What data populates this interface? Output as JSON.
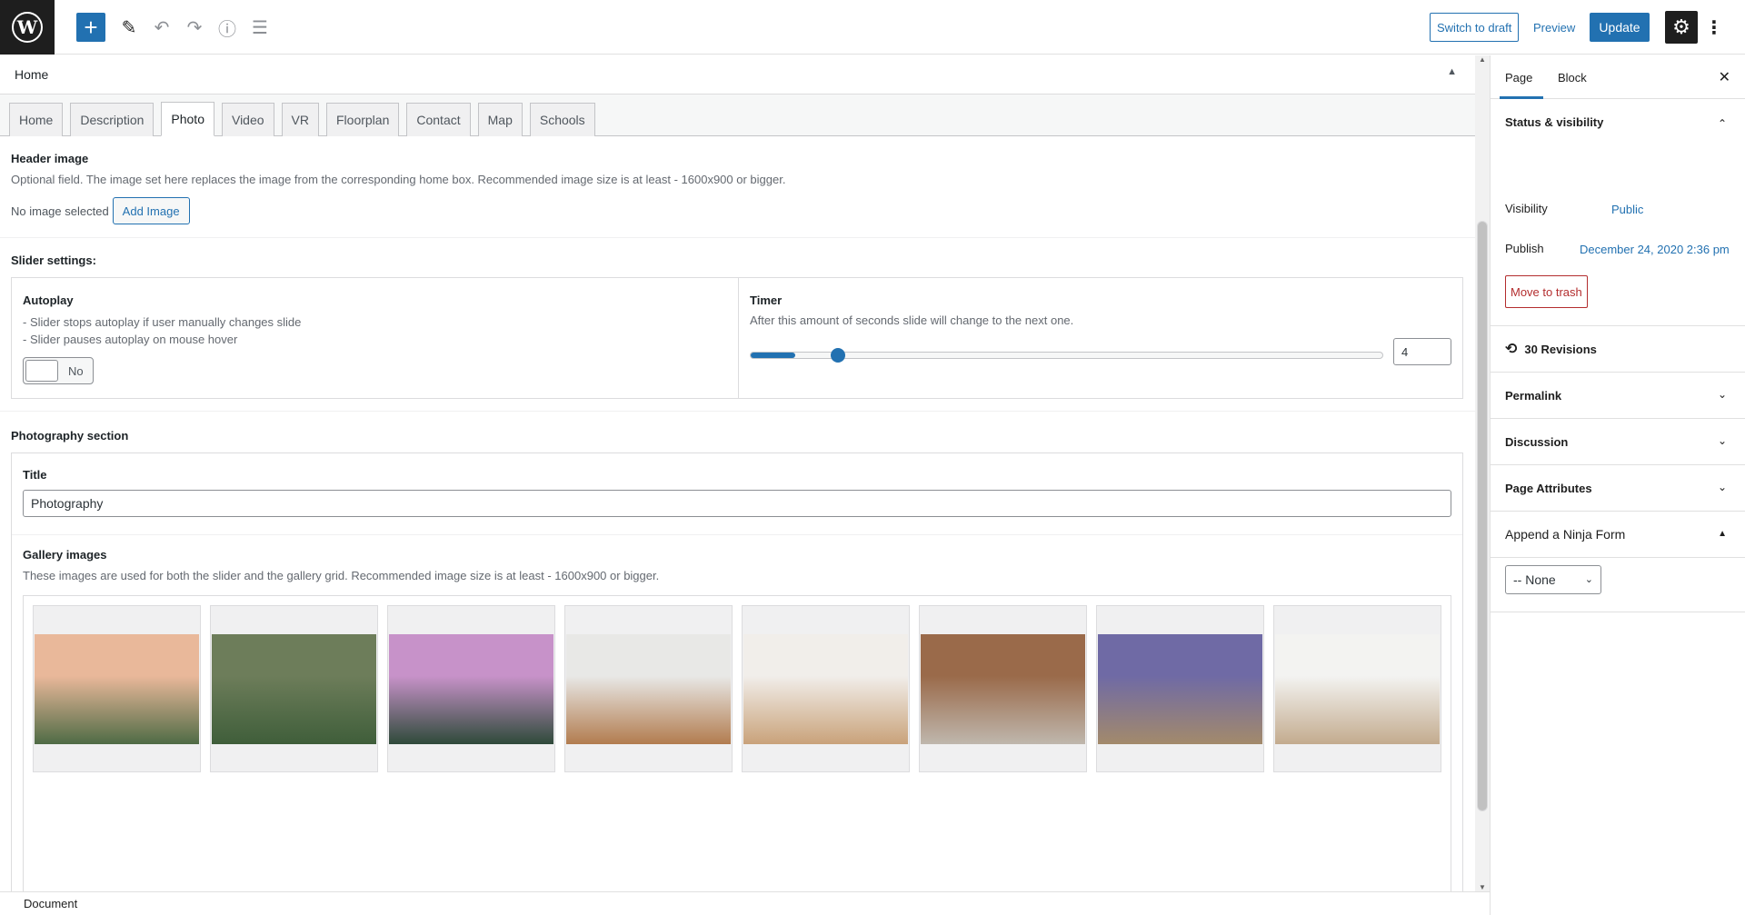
{
  "toolbar": {
    "logo_letter": "W",
    "add_icon": "+",
    "pencil_icon": "✎",
    "undo_icon": "↶",
    "redo_icon": "↷",
    "info_icon": "ⓘ",
    "outline_icon": "☰",
    "switch_to_draft": "Switch to draft",
    "preview": "Preview",
    "update": "Update",
    "settings_icon": "⚙",
    "more_icon": "⋮"
  },
  "metabox": {
    "title": "Home",
    "toggle_icon": "▲",
    "tabs": [
      "Home",
      "Description",
      "Photo",
      "Video",
      "VR",
      "Floorplan",
      "Contact",
      "Map",
      "Schools"
    ],
    "active_tab": "Photo"
  },
  "header_image": {
    "label": "Header image",
    "description": "Optional field. The image set here replaces the image from the corresponding home box. Recommended image size is at least - 1600x900 or bigger.",
    "no_image": "No image selected",
    "add_image": "Add Image"
  },
  "slider": {
    "section_label": "Slider settings:",
    "autoplay_label": "Autoplay",
    "autoplay_desc_1": "- Slider stops autoplay if user manually changes slide",
    "autoplay_desc_2": "- Slider pauses autoplay on mouse hover",
    "autoplay_value": "No",
    "timer_label": "Timer",
    "timer_desc": "After this amount of seconds slide will change to the next one.",
    "timer_value": "4",
    "timer_fraction": 0.07
  },
  "photography": {
    "section_label": "Photography section",
    "title_label": "Title",
    "title_value": "Photography",
    "gallery_label": "Gallery images",
    "gallery_desc": "These images are used for both the slider and the gallery grid. Recommended image size is at least - 1600x900 or bigger.",
    "images": [
      {
        "kind": "aerial-neighborhood",
        "sky": "#e9b89a",
        "ground": "#4f6b45"
      },
      {
        "kind": "aerial-house-tennis",
        "sky": "#6d7d5a",
        "ground": "#3f5e3a"
      },
      {
        "kind": "pool-terrace-dusk",
        "sky": "#c792c9",
        "ground": "#2f4a3a"
      },
      {
        "kind": "white-kitchen",
        "sky": "#e8e8e6",
        "ground": "#b27c4f"
      },
      {
        "kind": "bedroom-vaulted",
        "sky": "#f1eeea",
        "ground": "#c9a27a"
      },
      {
        "kind": "living-room",
        "sky": "#9a6a4a",
        "ground": "#bfb7ad"
      },
      {
        "kind": "house-exterior-night",
        "sky": "#6f6aa5",
        "ground": "#a38a6b"
      },
      {
        "kind": "open-living-space",
        "sky": "#f3f3f1",
        "ground": "#c3ab8e"
      }
    ]
  },
  "footer": {
    "label": "Document"
  },
  "sidebar": {
    "tab_page": "Page",
    "tab_block": "Block",
    "close_icon": "✕",
    "status_title": "Status & visibility",
    "visibility_label": "Visibility",
    "visibility_value": "Public",
    "publish_label": "Publish",
    "publish_value": "December 24, 2020 2:36 pm",
    "trash": "Move to trash",
    "revisions": "30 Revisions",
    "revisions_icon": "⟲",
    "permalink": "Permalink",
    "discussion": "Discussion",
    "page_attributes": "Page Attributes",
    "ninja_form": "Append a Ninja Form",
    "ninja_select": "-- None",
    "chevron_up": "⌃",
    "chevron_down": "⌄",
    "triangle_up": "▲"
  }
}
